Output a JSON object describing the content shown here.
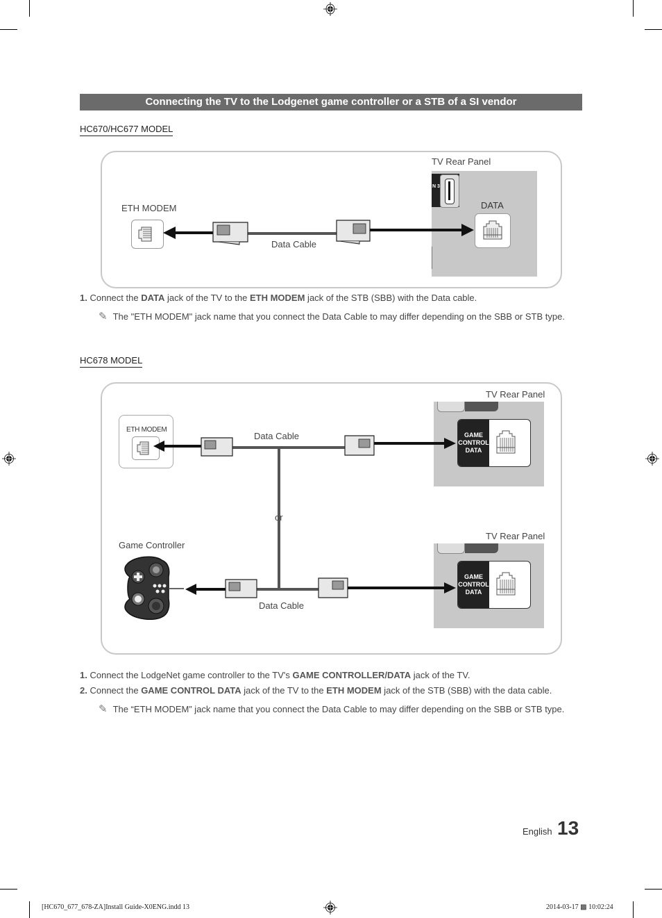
{
  "banner": {
    "title": "Connecting the TV to the Lodgenet game controller or a STB of a SI vendor"
  },
  "section1": {
    "model": "HC670/HC677 MODEL",
    "diagram": {
      "tv_rear_panel": "TV Rear Panel",
      "eth_modem": "ETH MODEM",
      "data_cable": "Data Cable",
      "data_jack": "DATA",
      "hdmi_partial": "N 3"
    },
    "steps": [
      {
        "num": "1.",
        "parts": [
          "Connect the ",
          "DATA",
          " jack of the TV to the ",
          "ETH MODEM",
          " jack of the STB (SBB) with the Data cable."
        ]
      }
    ],
    "note": "The \"ETH MODEM\" jack name that you connect the Data Cable to may differ depending on the SBB or STB type."
  },
  "section2": {
    "model": "HC678 MODEL",
    "diagram": {
      "tv_rear_panel_top": "TV Rear Panel",
      "tv_rear_panel_bottom": "TV Rear Panel",
      "eth_modem": "ETH MODEM",
      "data_cable_top": "Data Cable",
      "data_cable_bottom": "Data Cable",
      "or": "or",
      "game_controller": "Game Controller",
      "game_control_data": [
        "GAME",
        "CONTROL",
        "DATA"
      ]
    },
    "steps": [
      {
        "num": "1.",
        "parts": [
          "Connect the LodgeNet game controller to the TV's ",
          "GAME CONTROLLER/DATA",
          " jack of the TV."
        ]
      },
      {
        "num": "2.",
        "parts": [
          "Connect the ",
          "GAME CONTROL DATA",
          " jack of the TV to the ",
          "ETH MODEM",
          " jack of the STB (SBB) with the data cable."
        ]
      }
    ],
    "note": "The “ETH MODEM” jack name that you connect the Data Cable to may differ depending on the SBB or STB type."
  },
  "page": {
    "language": "English",
    "number": "13"
  },
  "print_footer": {
    "file": "[HC670_677_678-ZA]Install Guide-X0ENG.indd   13",
    "timestamp": "2014-03-17  ▩ 10:02:24"
  },
  "icons": {
    "note": "pencil-note-icon",
    "registration": "registration-mark-icon"
  }
}
